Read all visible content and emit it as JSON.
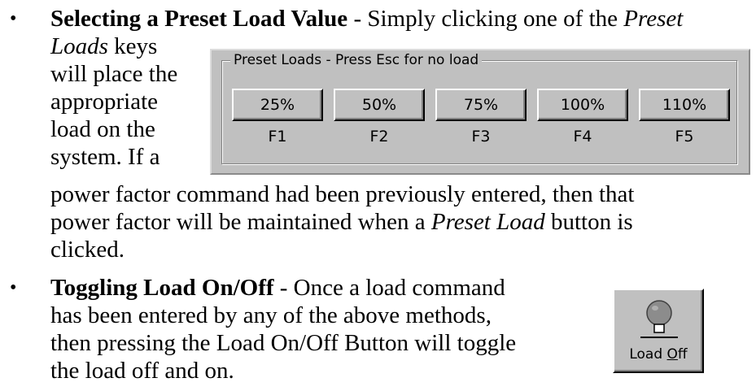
{
  "bullets": {
    "symbol": "•"
  },
  "section1": {
    "heading": "Selecting a Preset Load Value",
    "intro": " - Simply clicking one of the ",
    "term1": "Preset",
    "term2": "Loads",
    "line2_rest": " keys",
    "line3": "will place the",
    "line4": "appropriate",
    "line5": "load on the",
    "line6": "system.  If a",
    "line7": "power factor command had been previously entered, then that",
    "line8_a": "power factor will be maintained when a ",
    "line8_term": "Preset Load",
    "line8_b": " button is",
    "line9": "clicked."
  },
  "preset_panel": {
    "legend": "Preset Loads - Press Esc for no load",
    "buttons": [
      {
        "label": "25%",
        "key": "F1"
      },
      {
        "label": "50%",
        "key": "F2"
      },
      {
        "label": "75%",
        "key": "F3"
      },
      {
        "label": "100%",
        "key": "F4"
      },
      {
        "label": "110%",
        "key": "F5"
      }
    ]
  },
  "section2": {
    "heading": "Toggling Load On/Off",
    "line1_rest": " - Once a load command",
    "line2": "has been entered by any of the above methods,",
    "line3": "then pressing the Load On/Off Button will toggle",
    "line4": "the load off and on."
  },
  "load_button": {
    "label_prefix": "Load ",
    "label_hotkey": "O",
    "label_suffix": "ff",
    "icon": "lamp-icon"
  }
}
